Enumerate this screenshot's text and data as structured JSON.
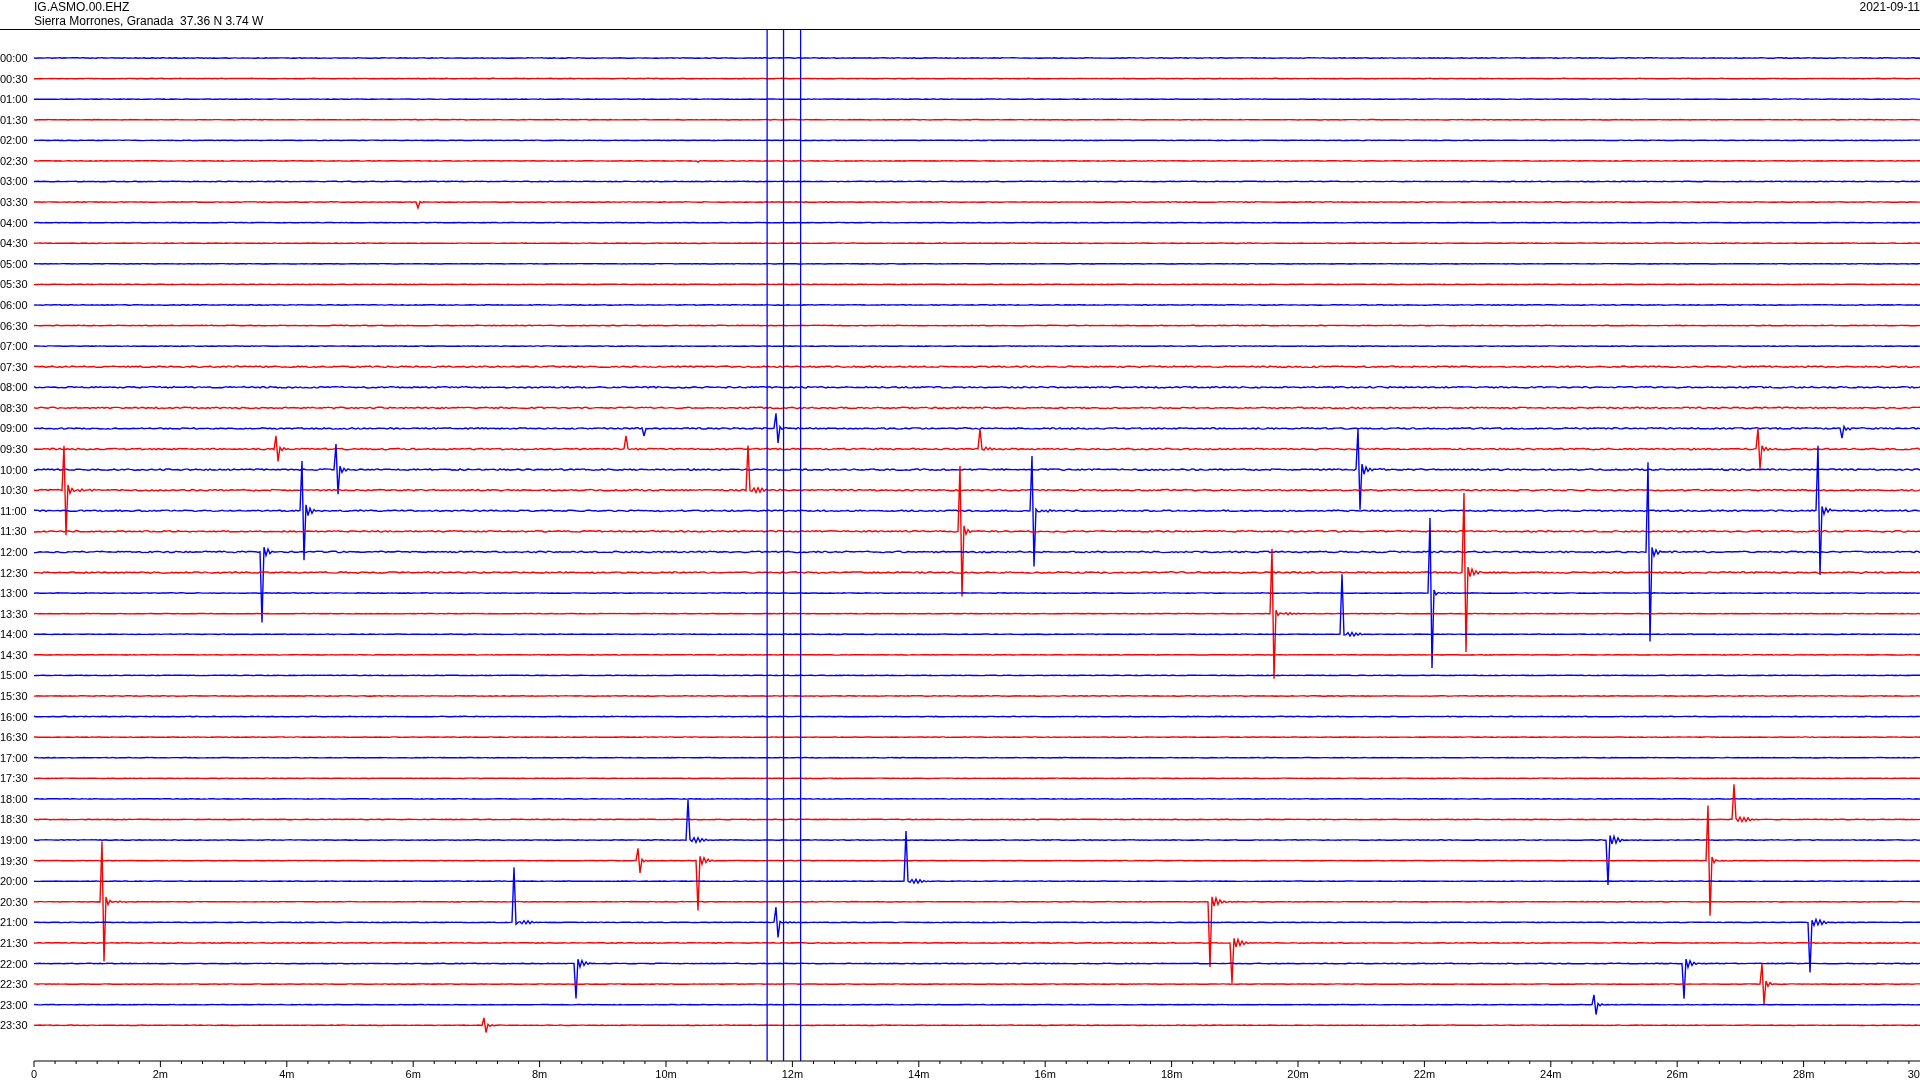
{
  "header": {
    "station": "IG.ASMO.00.EHZ",
    "location": "Sierra Morrones, Granada  37.36 N 3.74 W",
    "date": "2021-09-11"
  },
  "traces": [
    {
      "label": "00:00",
      "color": "#0000ff"
    },
    {
      "label": "00:30",
      "color": "#ff0000"
    },
    {
      "label": "01:00",
      "color": "#0000ff"
    },
    {
      "label": "01:30",
      "color": "#ff0000"
    },
    {
      "label": "02:00",
      "color": "#0000ff"
    },
    {
      "label": "02:30",
      "color": "#ff0000"
    },
    {
      "label": "03:00",
      "color": "#0000ff"
    },
    {
      "label": "03:30",
      "color": "#ff0000"
    },
    {
      "label": "04:00",
      "color": "#0000ff"
    },
    {
      "label": "04:30",
      "color": "#ff0000"
    },
    {
      "label": "05:00",
      "color": "#0000ff"
    },
    {
      "label": "05:30",
      "color": "#ff0000"
    },
    {
      "label": "06:00",
      "color": "#0000ff"
    },
    {
      "label": "06:30",
      "color": "#ff0000"
    },
    {
      "label": "07:00",
      "color": "#0000ff"
    },
    {
      "label": "07:30",
      "color": "#ff0000"
    },
    {
      "label": "08:00",
      "color": "#0000ff"
    },
    {
      "label": "08:30",
      "color": "#ff0000"
    },
    {
      "label": "09:00",
      "color": "#0000ff"
    },
    {
      "label": "09:30",
      "color": "#ff0000"
    },
    {
      "label": "10:00",
      "color": "#0000ff"
    },
    {
      "label": "10:30",
      "color": "#ff0000"
    },
    {
      "label": "11:00",
      "color": "#0000ff"
    },
    {
      "label": "11:30",
      "color": "#ff0000"
    },
    {
      "label": "12:00",
      "color": "#0000ff"
    },
    {
      "label": "12:30",
      "color": "#ff0000"
    },
    {
      "label": "13:00",
      "color": "#0000ff"
    },
    {
      "label": "13:30",
      "color": "#ff0000"
    },
    {
      "label": "14:00",
      "color": "#0000ff"
    },
    {
      "label": "14:30",
      "color": "#ff0000"
    },
    {
      "label": "15:00",
      "color": "#0000ff"
    },
    {
      "label": "15:30",
      "color": "#ff0000"
    },
    {
      "label": "16:00",
      "color": "#0000ff"
    },
    {
      "label": "16:30",
      "color": "#ff0000"
    },
    {
      "label": "17:00",
      "color": "#0000ff"
    },
    {
      "label": "17:30",
      "color": "#ff0000"
    },
    {
      "label": "18:00",
      "color": "#0000ff"
    },
    {
      "label": "18:30",
      "color": "#ff0000"
    },
    {
      "label": "19:00",
      "color": "#0000ff"
    },
    {
      "label": "19:30",
      "color": "#ff0000"
    },
    {
      "label": "20:00",
      "color": "#0000ff"
    },
    {
      "label": "20:30",
      "color": "#ff0000"
    },
    {
      "label": "21:00",
      "color": "#0000ff"
    },
    {
      "label": "21:30",
      "color": "#ff0000"
    },
    {
      "label": "22:00",
      "color": "#0000ff"
    },
    {
      "label": "22:30",
      "color": "#ff0000"
    },
    {
      "label": "23:00",
      "color": "#0000ff"
    },
    {
      "label": "23:30",
      "color": "#ff0000"
    }
  ],
  "axis_labels": [
    "0",
    "2m",
    "4m",
    "6m",
    "8m",
    "10m",
    "12m",
    "14m",
    "16m",
    "18m",
    "20m",
    "22m",
    "24m",
    "26m",
    "28m",
    "30"
  ]
}
